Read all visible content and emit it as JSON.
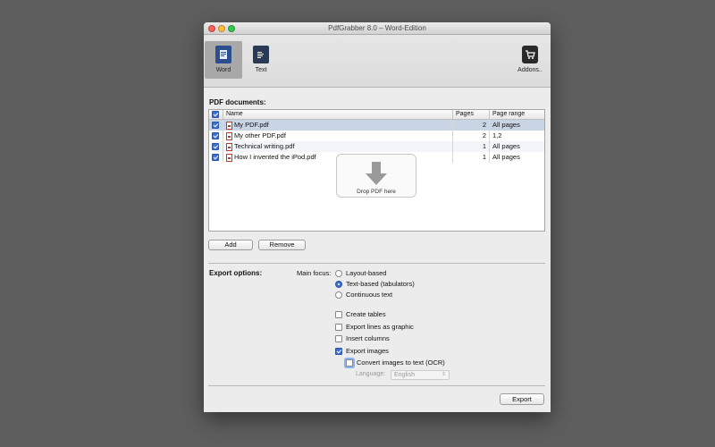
{
  "window": {
    "title": "PdfGrabber 8.0 – Word-Edition"
  },
  "colors": {
    "close": "#fc605b",
    "minimize": "#fdbc40",
    "zoom": "#34c84a",
    "selection": "#c9d4e4",
    "word_icon": "#2c4e8f",
    "text_icon": "#2a3a55"
  },
  "toolbar": {
    "word_label": "Word",
    "text_label": "Text",
    "addons_label": "Addons.."
  },
  "documents": {
    "section_label": "PDF documents:",
    "columns": {
      "name": "Name",
      "pages": "Pages",
      "range": "Page range"
    },
    "rows": [
      {
        "name": "My PDF.pdf",
        "pages": "2",
        "range": "All pages",
        "checked": true
      },
      {
        "name": "My other PDF.pdf",
        "pages": "2",
        "range": "1,2",
        "checked": true
      },
      {
        "name": "Technical writing.pdf",
        "pages": "1",
        "range": "All pages",
        "checked": true
      },
      {
        "name": "How I invented the iPod.pdf",
        "pages": "1",
        "range": "All pages",
        "checked": true
      }
    ],
    "drop_label": "Drop PDF here",
    "add_label": "Add",
    "remove_label": "Remove"
  },
  "export": {
    "section_label": "Export options:",
    "main_focus_label": "Main focus:",
    "focus_options": [
      {
        "label": "Layout-based",
        "selected": false
      },
      {
        "label": "Text-based (tabulators)",
        "selected": true
      },
      {
        "label": "Continuous text",
        "selected": false
      }
    ],
    "checkboxes": {
      "create_tables": {
        "label": "Create tables",
        "checked": false
      },
      "export_lines": {
        "label": "Export lines as graphic",
        "checked": false
      },
      "insert_columns": {
        "label": "Insert columns",
        "checked": false
      },
      "export_images": {
        "label": "Export images",
        "checked": true
      },
      "convert_ocr": {
        "label": "Convert images to text (OCR)",
        "checked": false
      }
    },
    "language_label": "Language:",
    "language_value": "English",
    "export_button": "Export"
  }
}
